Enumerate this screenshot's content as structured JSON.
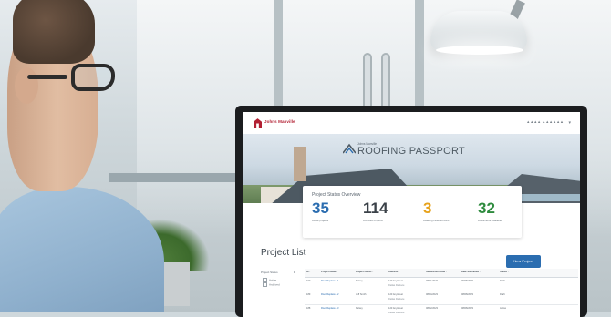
{
  "app": {
    "brand": "Johns Manville",
    "user_menu": "▲▲▲▲ ▲▲▲▲▲▲",
    "hero_brand_small": "Johns Manville",
    "hero_title": "ROOFING PASSPORT"
  },
  "status": {
    "title": "Project Status Overview",
    "stats": [
      {
        "value": "35",
        "label": "Active projects",
        "color": "#2b6db0"
      },
      {
        "value": "114",
        "label": "Archived Projects",
        "color": "#3a4148"
      },
      {
        "value": "3",
        "label": "Awaiting closeout docs",
        "color": "#e7a21b"
      },
      {
        "value": "32",
        "label": "Documents Available",
        "color": "#2e8b3e"
      }
    ]
  },
  "project_list": {
    "title": "Project List",
    "new_button": "New Project",
    "filter_label": "Project Status",
    "filter_options": [
      "Active",
      "Archived"
    ],
    "columns": [
      "ID",
      "Project Name",
      "Project Owner",
      "Address",
      "Submission Date",
      "Date Submitted",
      "Status"
    ],
    "rows": [
      {
        "id": "190",
        "name": "Roof Replace - 1",
        "owner": "Kelsey",
        "address": "123 Anystreet",
        "address2": "Dallas Replace",
        "sub": "08/01/2023",
        "date": "09/08/2023",
        "status": "Draft"
      },
      {
        "id": "189",
        "name": "Roof Replace - 2",
        "owner": "Jeff Smith",
        "address": "123 Anystreet",
        "address2": "Dallas Replace",
        "sub": "08/04/2023",
        "date": "08/08/2023",
        "status": "Draft"
      },
      {
        "id": "188",
        "name": "Roof Replace - 3",
        "owner": "Kelsey",
        "address": "123 Anystreet",
        "address2": "Dallas Replace",
        "sub": "08/02/2023",
        "date": "08/08/2023",
        "status": "Active"
      }
    ]
  },
  "colors": {
    "accent": "#2b6db0",
    "brand_red": "#b22033",
    "pending": "#e7a21b",
    "success": "#2e8b3e"
  }
}
